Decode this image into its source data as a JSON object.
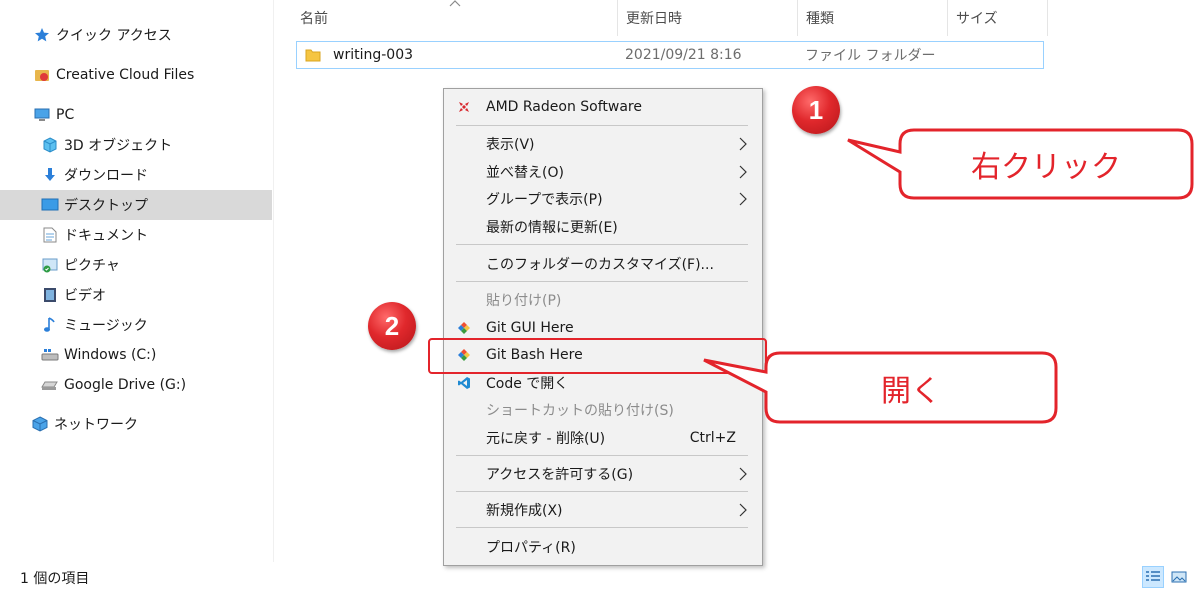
{
  "sidebar": {
    "items": [
      {
        "label": "クイック アクセス",
        "icon": "star-icon"
      },
      {
        "label": "Creative Cloud Files",
        "icon": "creative-cloud-icon"
      },
      {
        "label": "PC",
        "icon": "pc-icon"
      },
      {
        "label": "3D オブジェクト",
        "icon": "3d-objects-icon"
      },
      {
        "label": "ダウンロード",
        "icon": "download-icon"
      },
      {
        "label": "デスクトップ",
        "icon": "desktop-icon",
        "selected": true
      },
      {
        "label": "ドキュメント",
        "icon": "document-icon"
      },
      {
        "label": "ピクチャ",
        "icon": "pictures-icon"
      },
      {
        "label": "ビデオ",
        "icon": "video-icon"
      },
      {
        "label": "ミュージック",
        "icon": "music-icon"
      },
      {
        "label": "Windows (C:)",
        "icon": "drive-c-icon"
      },
      {
        "label": "Google Drive (G:)",
        "icon": "google-drive-icon"
      },
      {
        "label": "ネットワーク",
        "icon": "network-icon"
      }
    ]
  },
  "columns": {
    "name": "名前",
    "modified": "更新日時",
    "type": "種類",
    "size": "サイズ"
  },
  "file": {
    "name": "writing-003",
    "modified": "2021/09/21 8:16",
    "type": "ファイル フォルダー",
    "icon": "folder-icon"
  },
  "context_menu": {
    "items": [
      {
        "label": "AMD Radeon Software",
        "icon": "amd-radeon-icon"
      },
      {
        "label": "表示(V)",
        "submenu": true
      },
      {
        "label": "並べ替え(O)",
        "submenu": true
      },
      {
        "label": "グループで表示(P)",
        "submenu": true
      },
      {
        "label": "最新の情報に更新(E)"
      },
      {
        "label": "このフォルダーのカスタマイズ(F)..."
      },
      {
        "label": "貼り付け(P)",
        "disabled": true
      },
      {
        "label": "Git GUI Here",
        "icon": "git-icon"
      },
      {
        "label": "Git Bash Here",
        "icon": "git-icon"
      },
      {
        "label": "Code で開く",
        "icon": "vscode-icon"
      },
      {
        "label": "ショートカットの貼り付け(S)",
        "disabled": true
      },
      {
        "label": "元に戻す - 削除(U)",
        "shortcut": "Ctrl+Z"
      },
      {
        "label": "アクセスを許可する(G)",
        "submenu": true
      },
      {
        "label": "新規作成(X)",
        "submenu": true
      },
      {
        "label": "プロパティ(R)"
      }
    ]
  },
  "annotations": {
    "badge1": "1",
    "badge2": "2",
    "callout1": "右クリック",
    "callout2": "開く",
    "color": "#e3242b"
  },
  "status": {
    "item_count": "1 個の項目"
  },
  "colors": {
    "selection_bg": "#d9d9d9",
    "row_border": "#99d1ff",
    "menu_bg": "#f2f2f2",
    "accent_red": "#e3242b"
  }
}
